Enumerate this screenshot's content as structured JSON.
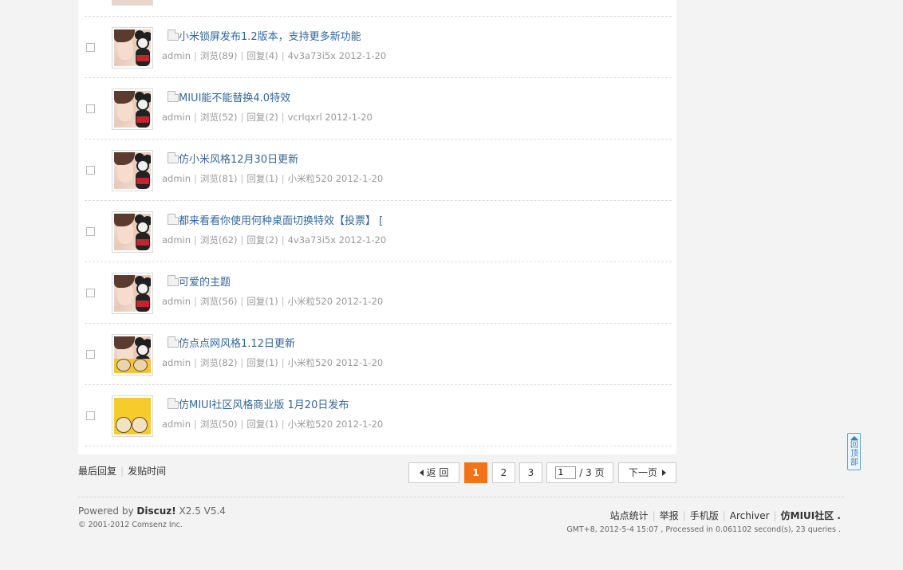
{
  "threads": [
    {
      "title": "小米锁屏发布1.2版本，支持更多新功能",
      "author": "admin",
      "views": "浏览(89)",
      "replies": "回复(4)",
      "last_poster": "4v3a73i5x",
      "date": "2012-1-20",
      "avatar": "girl-mouse"
    },
    {
      "title": "MIUI能不能替换4.0特效",
      "author": "admin",
      "views": "浏览(52)",
      "replies": "回复(2)",
      "last_poster": "vcrlqxrl",
      "date": "2012-1-20",
      "avatar": "girl-mouse"
    },
    {
      "title": "仿小米风格12月30日更新",
      "author": "admin",
      "views": "浏览(81)",
      "replies": "回复(1)",
      "last_poster": "小米粒520",
      "date": "2012-1-20",
      "avatar": "girl-mouse"
    },
    {
      "title": "都来看看你使用何种桌面切换特效【投票】 [",
      "author": "admin",
      "views": "浏览(62)",
      "replies": "回复(2)",
      "last_poster": "4v3a73i5x",
      "date": "2012-1-20",
      "avatar": "girl-mouse"
    },
    {
      "title": "可爱的主题",
      "author": "admin",
      "views": "浏览(56)",
      "replies": "回复(1)",
      "last_poster": "小米粒520",
      "date": "2012-1-20",
      "avatar": "girl-mouse"
    },
    {
      "title": "仿点点网风格1.12日更新",
      "author": "admin",
      "views": "浏览(82)",
      "replies": "回复(1)",
      "last_poster": "小米粒520",
      "date": "2012-1-20",
      "avatar": "girl-bears"
    },
    {
      "title": "仿MIUI社区风格商业版 1月20日发布",
      "author": "admin",
      "views": "浏览(50)",
      "replies": "回复(1)",
      "last_poster": "小米粒520",
      "date": "2012-1-20",
      "avatar": "yellow-bears"
    }
  ],
  "sort": {
    "last_reply": "最后回复",
    "post_time": "发贴时间"
  },
  "pagination": {
    "prev": "返 回",
    "pages": [
      "1",
      "2",
      "3"
    ],
    "current": "1",
    "input_value": "1",
    "total": "/ 3 页",
    "next": "下一页"
  },
  "footer": {
    "powered_prefix": "Powered by ",
    "powered_product": "Discuz!",
    "powered_version": " X2.5 V5.4",
    "copyright": "© 2001-2012 Comsenz Inc.",
    "links": [
      "站点统计",
      "举报",
      "手机版",
      "Archiver"
    ],
    "site_name": "仿MIUI社区 .",
    "timing": "GMT+8, 2012-5-4 15:07 , Processed in 0.061102 second(s), 23 queries ."
  },
  "back_to_top": "回顶部",
  "colors": {
    "accent": "#f27318",
    "link": "#336699",
    "page_bg": "#f3f3f3"
  }
}
